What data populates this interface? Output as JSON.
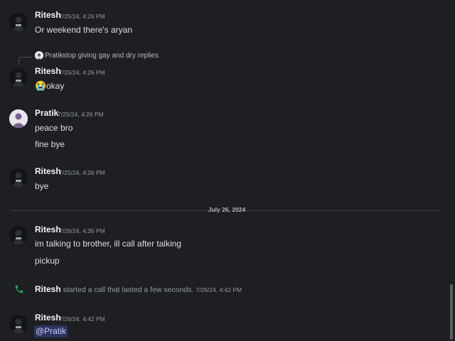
{
  "messages": [
    {
      "author": "Ritesh",
      "timestamp": "7/25/24, 4:26 PM",
      "text": "Or weekend there's aryan"
    },
    {
      "reply": {
        "author": "Pratik",
        "text": "stop giving gay and dry replies"
      },
      "author": "Ritesh",
      "timestamp": "7/25/24, 4:26 PM",
      "emoji": "😭",
      "text": "okay"
    },
    {
      "author": "Pratik",
      "timestamp": "7/25/24, 4:26 PM",
      "text": "peace bro",
      "followup": "fine bye"
    },
    {
      "author": "Ritesh",
      "timestamp": "7/25/24, 4:26 PM",
      "text": "bye"
    },
    {
      "author": "Ritesh",
      "timestamp": "7/26/24, 4:35 PM",
      "text": "im talking to brother, ill call after talking",
      "followup": "pickup"
    },
    {
      "author": "Ritesh",
      "timestamp": "7/26/24, 4:42 PM",
      "mention": "@Pratik"
    }
  ],
  "date_divider": "July 26, 2024",
  "call_event": {
    "author": "Ritesh",
    "text": "started a call that lasted a few seconds.",
    "timestamp": "7/26/24, 4:42 PM",
    "icon": "phone-icon",
    "icon_color": "#23a55a"
  },
  "colors": {
    "background": "#1e1f22",
    "mention_bg": "#5865f2",
    "mention_text": "#c9cdfb"
  }
}
